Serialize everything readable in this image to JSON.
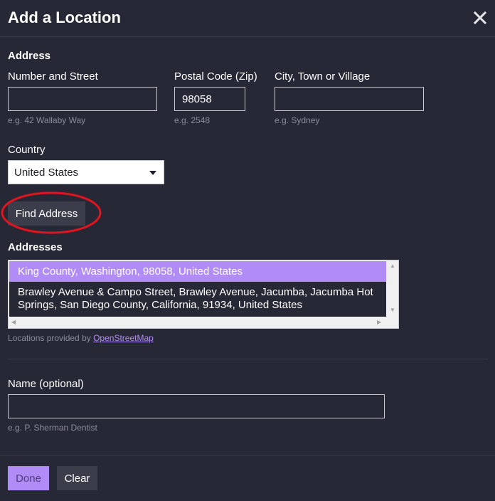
{
  "dialog": {
    "title": "Add a Location",
    "close_icon": "close-icon"
  },
  "address": {
    "section_label": "Address",
    "street": {
      "label": "Number and Street",
      "value": "",
      "hint": "e.g. 42 Wallaby Way"
    },
    "postal": {
      "label": "Postal Code (Zip)",
      "value": "98058",
      "hint": "e.g. 2548"
    },
    "city": {
      "label": "City, Town or Village",
      "value": "",
      "hint": "e.g. Sydney"
    },
    "country": {
      "label": "Country",
      "selected": "United States"
    }
  },
  "find_button": {
    "label": "Find Address"
  },
  "addresses": {
    "label": "Addresses",
    "items": [
      {
        "text": "King County, Washington, 98058, United States",
        "selected": true
      },
      {
        "text": "Brawley Avenue & Campo Street, Brawley Avenue, Jacumba, Jacumba Hot Springs, San Diego County, California, 91934, United States",
        "selected": false
      }
    ],
    "credit_prefix": "Locations provided by",
    "credit_link": "OpenStreetMap"
  },
  "name_field": {
    "label": "Name (optional)",
    "value": "",
    "hint": "e.g. P. Sherman Dentist"
  },
  "footer": {
    "done_label": "Done",
    "clear_label": "Clear"
  },
  "colors": {
    "accent": "#b28cf6",
    "background": "#262836",
    "annotation": "#e0141e"
  }
}
